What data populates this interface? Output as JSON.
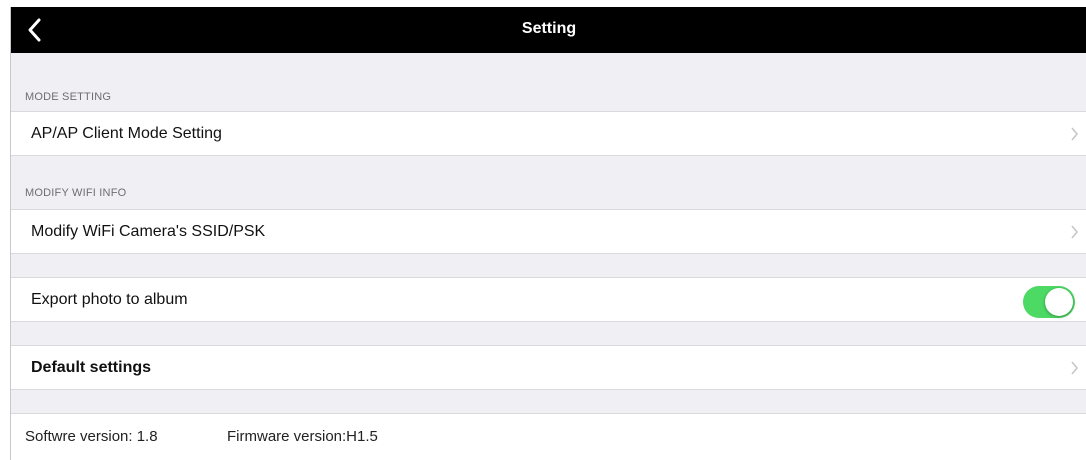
{
  "navbar": {
    "title": "Setting",
    "back_icon": "chevron-left-icon"
  },
  "sections": {
    "mode_header": "MODE SETTING",
    "mode_row": "AP/AP Client Mode Setting",
    "wifi_header": "MODIFY WIFI INFO",
    "wifi_row": "Modify WiFi Camera's SSID/PSK",
    "export_row": "Export photo to album",
    "export_enabled": true,
    "default_row": "Default settings"
  },
  "footer": {
    "software_version": "Softwre version: 1.8",
    "firmware_version": "Firmware version:H1.5"
  },
  "colors": {
    "navbar_bg": "#000000",
    "toggle_on": "#4cd964",
    "group_bg": "#efeff4"
  }
}
